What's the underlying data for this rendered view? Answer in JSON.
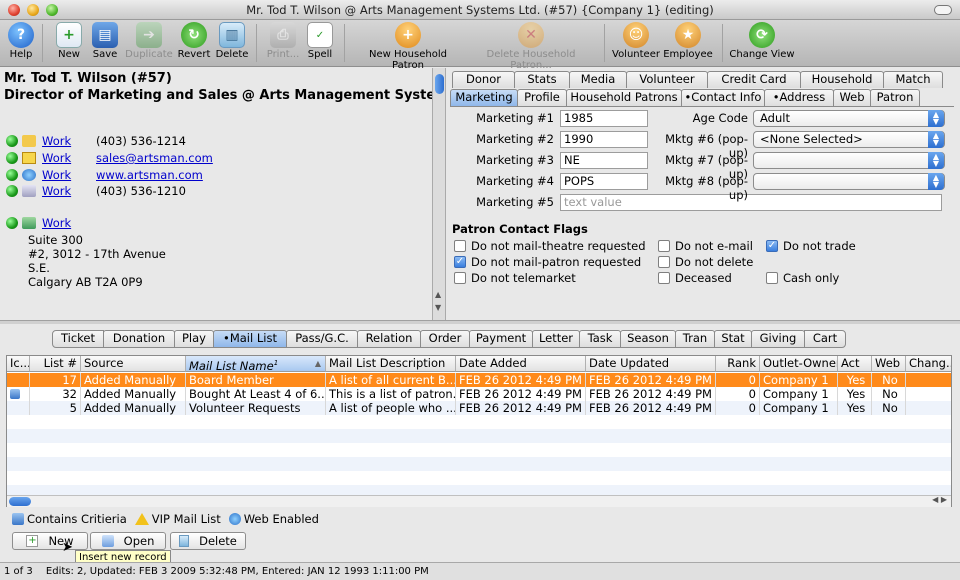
{
  "window": {
    "title": "Mr. Tod T. Wilson @ Arts Management Systems Ltd. (#57) {Company 1} (editing)"
  },
  "toolbar": [
    {
      "label": "Help",
      "icon": "help-icon",
      "enabled": true
    },
    {
      "label": "New",
      "icon": "new-icon",
      "enabled": true
    },
    {
      "label": "Save",
      "icon": "save-icon",
      "enabled": true
    },
    {
      "label": "Duplicate",
      "icon": "duplicate-icon",
      "enabled": false
    },
    {
      "label": "Revert",
      "icon": "revert-icon",
      "enabled": true
    },
    {
      "label": "Delete",
      "icon": "trash-icon",
      "enabled": true
    },
    {
      "label": "Print...",
      "icon": "print-icon",
      "enabled": false
    },
    {
      "label": "Spell",
      "icon": "spell-icon",
      "enabled": true
    },
    {
      "label": "New Household Patron",
      "icon": "household-add-icon",
      "enabled": true
    },
    {
      "label": "Delete Household Patron...",
      "icon": "household-delete-icon",
      "enabled": false
    },
    {
      "label": "Volunteer",
      "icon": "volunteer-icon",
      "enabled": true
    },
    {
      "label": "Employee",
      "icon": "employee-icon",
      "enabled": true
    },
    {
      "label": "Change View",
      "icon": "change-view-icon",
      "enabled": true
    }
  ],
  "patron": {
    "name": "Mr. Tod T. Wilson (#57)",
    "subtitle": "Director of Marketing and Sales @ Arts Management Systems Ltd",
    "contacts": [
      {
        "icon": "phone-icon",
        "type": "Work",
        "value": "(403) 536-1214",
        "link": false
      },
      {
        "icon": "email-icon",
        "type": "Work",
        "value": "sales@artsman.com",
        "link": true
      },
      {
        "icon": "web-icon",
        "type": "Work",
        "value": "www.artsman.com",
        "link": true
      },
      {
        "icon": "fax-icon",
        "type": "Work",
        "value": "(403) 536-1210",
        "link": false
      }
    ],
    "address": {
      "type": "Work",
      "lines": [
        "Suite 300",
        "#2, 3012 - 17th Avenue",
        "S.E.",
        "Calgary AB  T2A 0P9"
      ]
    }
  },
  "detail_tabs": {
    "row1": [
      "Donor",
      "Stats",
      "Media",
      "Volunteer",
      "Credit Card",
      "Household",
      "Match"
    ],
    "row2": [
      "Marketing",
      "Profile",
      "Household Patrons",
      "•Contact Info",
      "•Address",
      "Web",
      "Patron"
    ],
    "selected": "Marketing"
  },
  "marketing": {
    "fields": [
      {
        "label": "Marketing #1",
        "value": "1985"
      },
      {
        "label": "Marketing #2",
        "value": "1990"
      },
      {
        "label": "Marketing #3",
        "value": "NE"
      },
      {
        "label": "Marketing #4",
        "value": "POPS"
      },
      {
        "label": "Marketing #5",
        "value": "",
        "placeholder": "text value"
      }
    ],
    "popups": [
      {
        "label": "Age Code",
        "value": "Adult"
      },
      {
        "label": "Mktg #6 (pop-up)",
        "value": "<None Selected>"
      },
      {
        "label": "Mktg #7 (pop-up)",
        "value": ""
      },
      {
        "label": "Mktg #8 (pop-up)",
        "value": ""
      }
    ],
    "flags_title": "Patron Contact Flags",
    "flags": [
      {
        "label": "Do not mail-theatre requested",
        "checked": false
      },
      {
        "label": "Do not mail-patron requested",
        "checked": true
      },
      {
        "label": "Do not telemarket",
        "checked": false
      },
      {
        "label": "Do not e-mail",
        "checked": false
      },
      {
        "label": "Do not delete",
        "checked": false
      },
      {
        "label": "Deceased",
        "checked": false
      },
      {
        "label": "Do not trade",
        "checked": true
      },
      {
        "label": "Cash only",
        "checked": false
      }
    ]
  },
  "bottom_tabs": {
    "items": [
      "Ticket",
      "Donation",
      "Play",
      "•Mail List",
      "Pass/G.C.",
      "Relation",
      "Order",
      "Payment",
      "Letter",
      "Task",
      "Season",
      "Tran",
      "Stat",
      "Giving",
      "Cart"
    ],
    "selected": "•Mail List"
  },
  "grid": {
    "columns": [
      "Ic...",
      "List #",
      "Source",
      "Mail List Name",
      "Mail List Description",
      "Date Added",
      "Date Updated",
      "Rank",
      "Outlet-Owner",
      "Act",
      "Web",
      "Chang..."
    ],
    "sorted_column": "Mail List Name",
    "sort_index": "1",
    "rows": [
      [
        "",
        "17",
        "Added Manually",
        "Board Member",
        "A list of all current B...",
        "FEB 26 2012 4:49 PM",
        "FEB 26 2012 4:49 PM",
        "0",
        "Company 1",
        "Yes",
        "No",
        ""
      ],
      [
        "",
        "32",
        "Added Manually",
        "Bought At Least 4 of 6...",
        "This is a list of patron...",
        "FEB 26 2012 4:49 PM",
        "FEB 26 2012 4:49 PM",
        "0",
        "Company 1",
        "Yes",
        "No",
        ""
      ],
      [
        "",
        "5",
        "Added Manually",
        "Volunteer Requests",
        "A list of people who ...",
        "FEB 26 2012 4:49 PM",
        "FEB 26 2012 4:49 PM",
        "0",
        "Company 1",
        "Yes",
        "No",
        ""
      ]
    ],
    "selected_row": 0
  },
  "legend": [
    {
      "icon": "criteria-icon",
      "label": "Contains Critieria"
    },
    {
      "icon": "warning-icon",
      "label": "VIP Mail List"
    },
    {
      "icon": "globe-icon",
      "label": "Web Enabled"
    }
  ],
  "actions": {
    "new": "New",
    "open": "Open",
    "delete": "Delete"
  },
  "tooltip": "Insert new record",
  "status": {
    "record": "1 of 3",
    "info": "Edits: 2, Updated: FEB 3 2009 5:32:48 PM, Entered: JAN 12 1993 1:11:00 PM"
  }
}
